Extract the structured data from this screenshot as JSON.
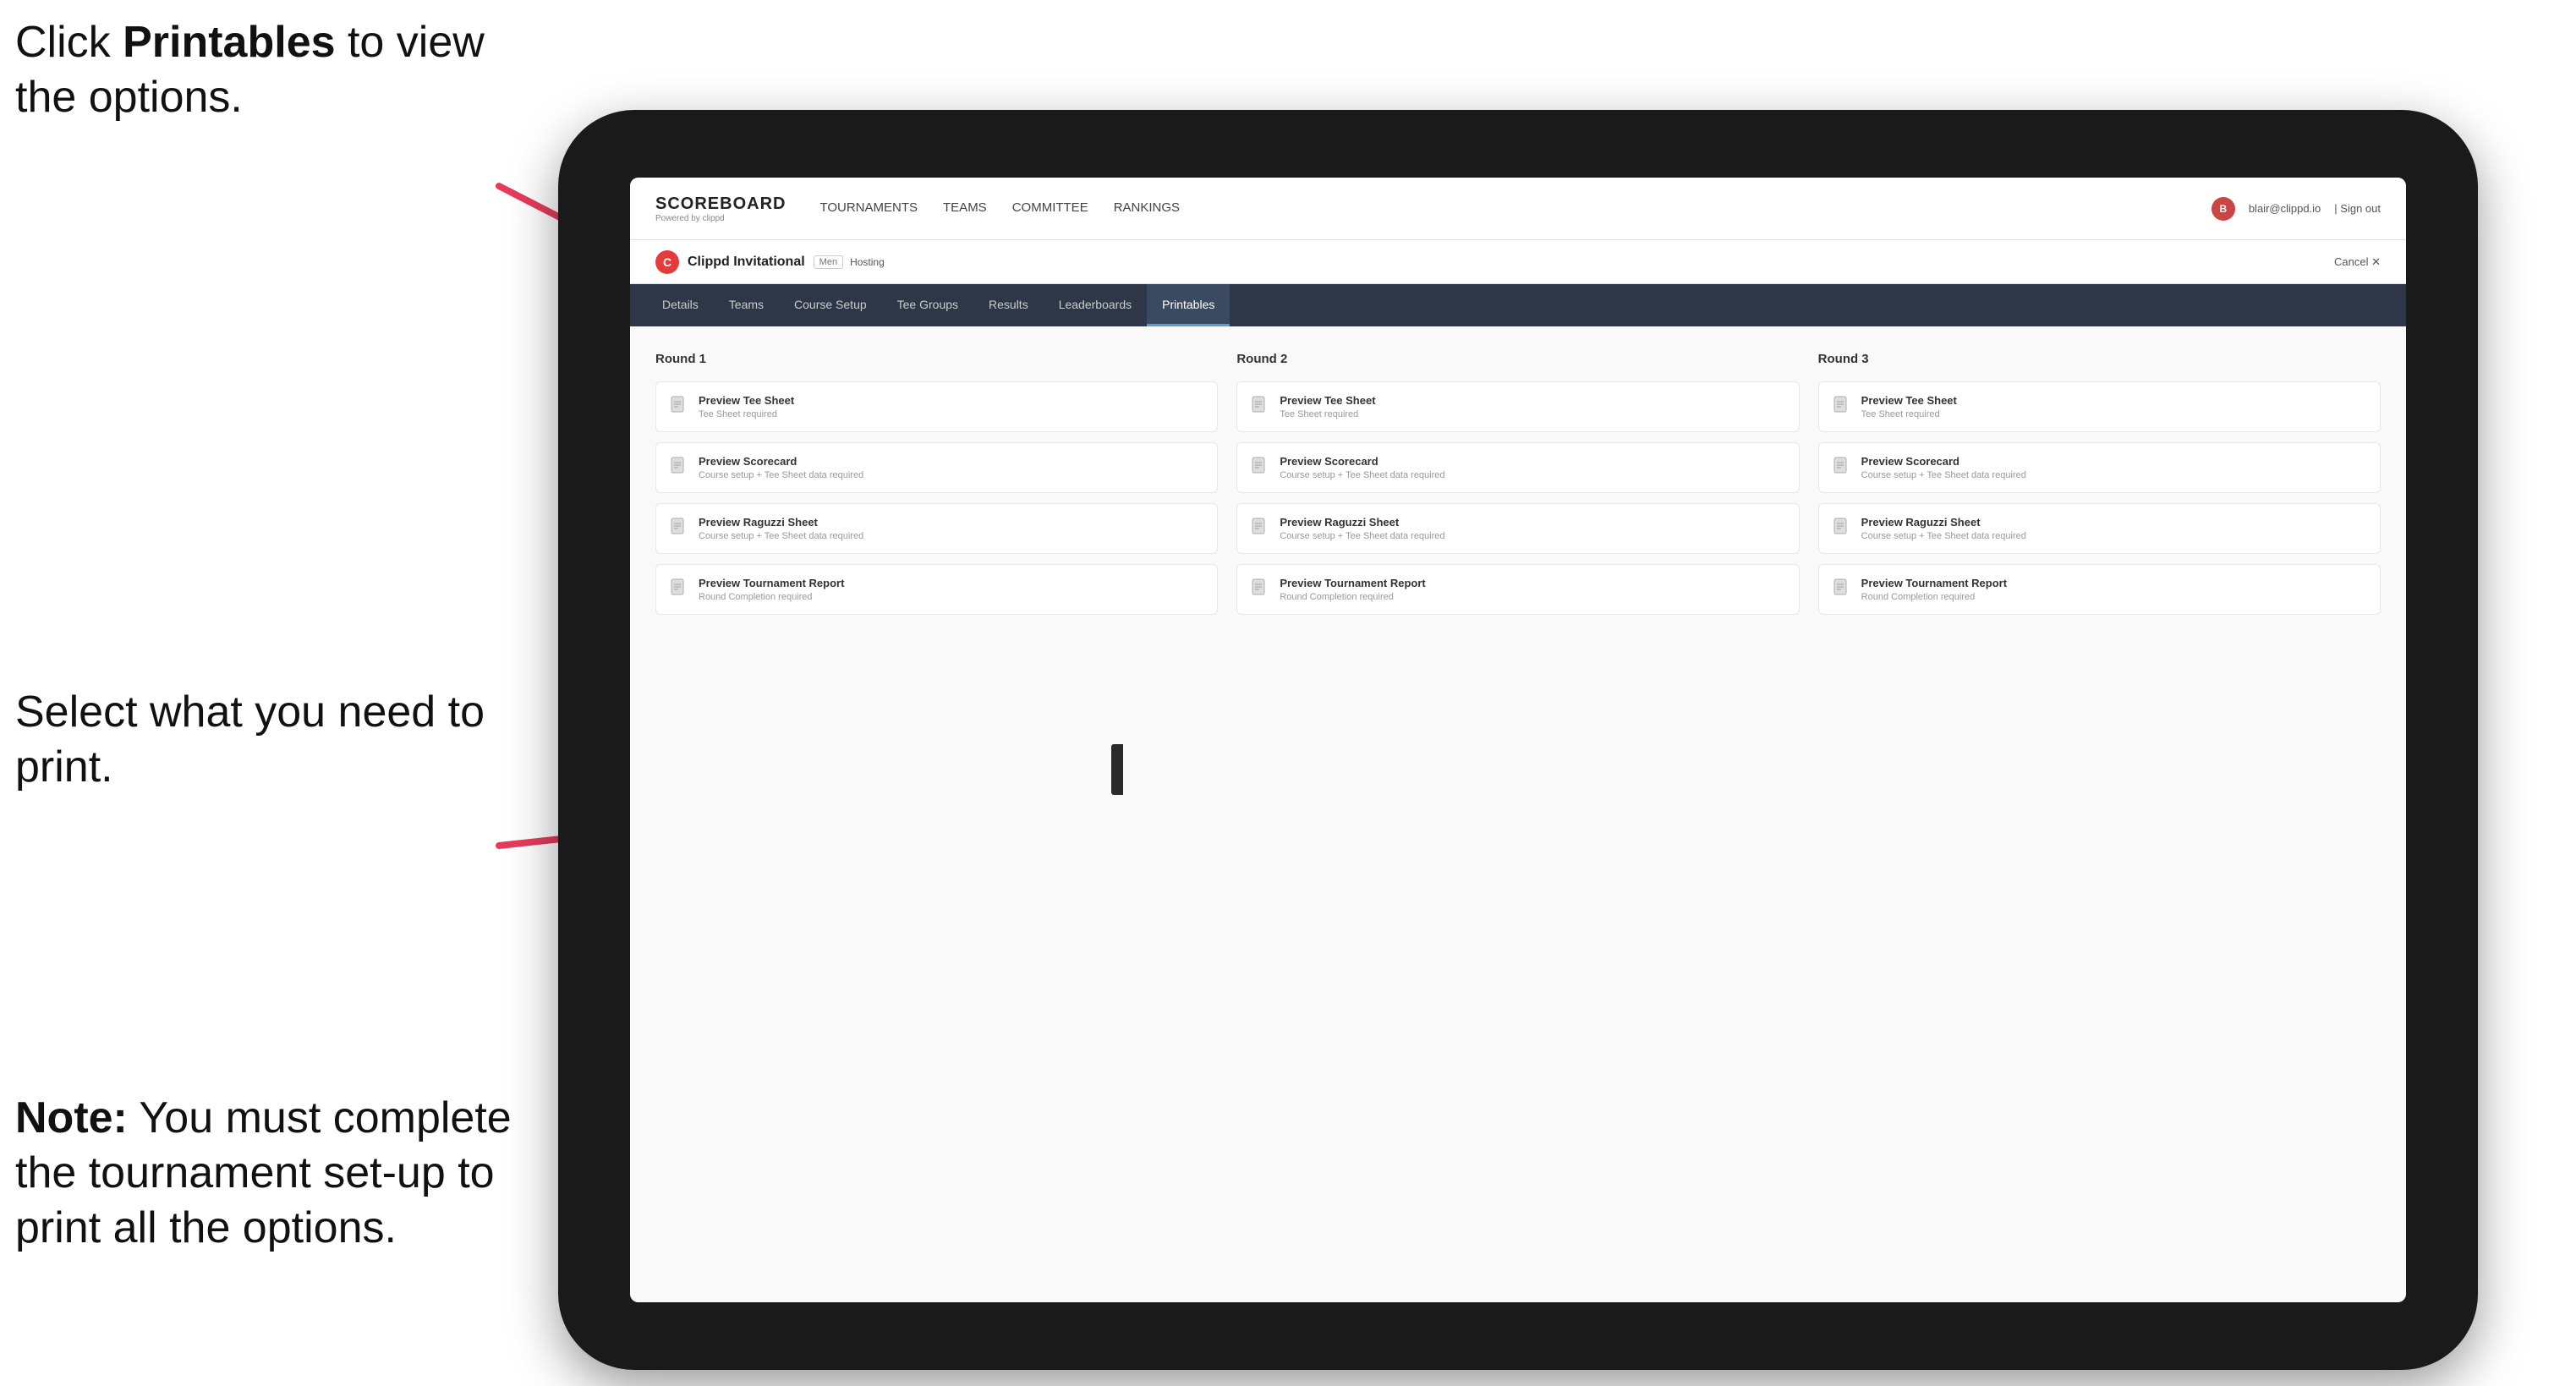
{
  "annotations": {
    "top_text_part1": "Click ",
    "top_text_bold": "Printables",
    "top_text_part2": " to view the options.",
    "mid_text": "Select what you need to print.",
    "bottom_text_bold": "Note:",
    "bottom_text": " You must complete the tournament set-up to print all the options."
  },
  "nav": {
    "logo_title": "SCOREBOARD",
    "logo_sub": "Powered by clippd",
    "links": [
      "TOURNAMENTS",
      "TEAMS",
      "COMMITTEE",
      "RANKINGS"
    ],
    "user_email": "blair@clippd.io",
    "sign_out": "Sign out"
  },
  "tournament_bar": {
    "logo_letter": "C",
    "name": "Clippd Invitational",
    "badge": "Men",
    "status": "Hosting",
    "cancel": "Cancel  ✕"
  },
  "tabs": [
    "Details",
    "Teams",
    "Course Setup",
    "Tee Groups",
    "Results",
    "Leaderboards",
    "Printables"
  ],
  "active_tab": "Printables",
  "rounds": [
    {
      "title": "Round 1",
      "cards": [
        {
          "title": "Preview Tee Sheet",
          "sub": "Tee Sheet required"
        },
        {
          "title": "Preview Scorecard",
          "sub": "Course setup + Tee Sheet data required"
        },
        {
          "title": "Preview Raguzzi Sheet",
          "sub": "Course setup + Tee Sheet data required"
        },
        {
          "title": "Preview Tournament Report",
          "sub": "Round Completion required"
        }
      ]
    },
    {
      "title": "Round 2",
      "cards": [
        {
          "title": "Preview Tee Sheet",
          "sub": "Tee Sheet required"
        },
        {
          "title": "Preview Scorecard",
          "sub": "Course setup + Tee Sheet data required"
        },
        {
          "title": "Preview Raguzzi Sheet",
          "sub": "Course setup + Tee Sheet data required"
        },
        {
          "title": "Preview Tournament Report",
          "sub": "Round Completion required"
        }
      ]
    },
    {
      "title": "Round 3",
      "cards": [
        {
          "title": "Preview Tee Sheet",
          "sub": "Tee Sheet required"
        },
        {
          "title": "Preview Scorecard",
          "sub": "Course setup + Tee Sheet data required"
        },
        {
          "title": "Preview Raguzzi Sheet",
          "sub": "Course setup + Tee Sheet data required"
        },
        {
          "title": "Preview Tournament Report",
          "sub": "Round Completion required"
        }
      ]
    }
  ]
}
